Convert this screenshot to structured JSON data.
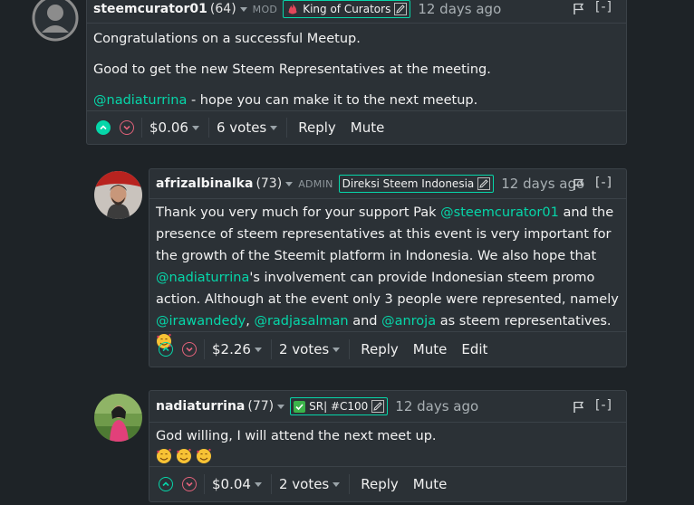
{
  "comments": [
    {
      "author": "steemcurator01",
      "reputation": "(64)",
      "role": "MOD",
      "badge": "King of Curators",
      "time": "12 days ago",
      "collapse": "[-]",
      "paragraphs": [
        "Congratulations on a successful Meetup.",
        "Good to get the new Steem Representatives at the meeting."
      ],
      "mention_line": {
        "mention": "@nadiaturrina",
        "text": " - hope you can make it to the next meetup."
      },
      "payout": "$0.06",
      "votes": "6 votes",
      "actions": [
        "Reply",
        "Mute"
      ]
    },
    {
      "author": "afrizalbinalka",
      "reputation": "(73)",
      "role": "ADMIN",
      "badge": "Direksi Steem Indonesia",
      "time": "12 days ago",
      "collapse": "[-]",
      "body": {
        "t1": "Thank you very much for your support Pak ",
        "m1": "@steemcurator01",
        "t2": " and the presence of steem representatives at this event is very important for the growth of the Steemit platform in Indonesia. We also hope that ",
        "m2": "@nadiaturrina",
        "t3": "'s involvement can provide Indonesian steem promo action. Although at the event only 3 people were represented, namely ",
        "m3": "@irawandedy",
        "t4": ", ",
        "m4": "@radjasalman",
        "t5": " and ",
        "m5": "@anroja",
        "t6": " as steem representatives."
      },
      "payout": "$2.26",
      "votes": "2 votes",
      "actions": [
        "Reply",
        "Mute",
        "Edit"
      ]
    },
    {
      "author": "nadiaturrina",
      "reputation": "(77)",
      "badge": "SR| #C100",
      "time": "12 days ago",
      "collapse": "[-]",
      "text": "God willing, I will attend the next meet up.",
      "payout": "$0.04",
      "votes": "2 votes",
      "actions": [
        "Reply",
        "Mute"
      ]
    }
  ],
  "colors": {
    "accent": "#06d6a9",
    "downvote": "#e2627a",
    "background": "#1e2327",
    "card": "#2b3136"
  }
}
